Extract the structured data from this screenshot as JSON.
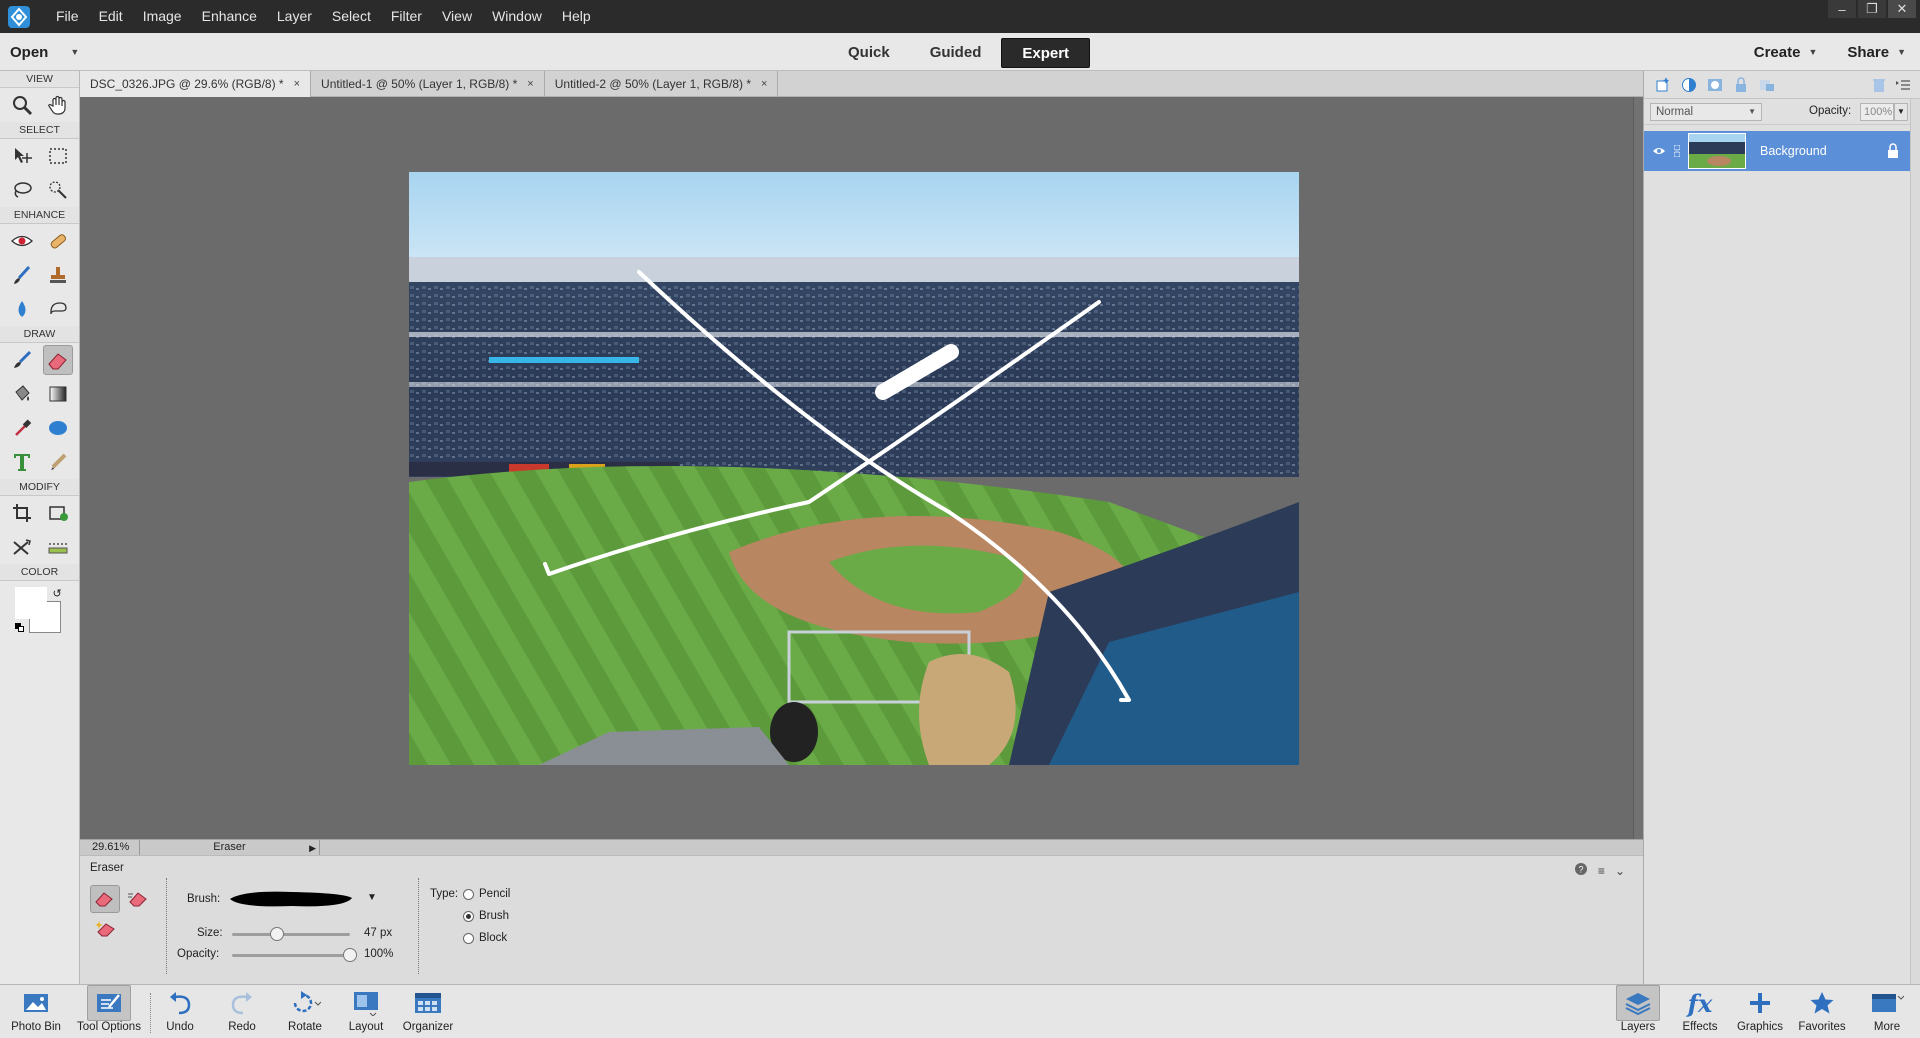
{
  "menubar": {
    "items": [
      "File",
      "Edit",
      "Image",
      "Enhance",
      "Layer",
      "Select",
      "Filter",
      "View",
      "Window",
      "Help"
    ]
  },
  "modebar": {
    "open_label": "Open",
    "modes": [
      "Quick",
      "Guided",
      "Expert"
    ],
    "active_mode": "Expert",
    "create_label": "Create",
    "share_label": "Share"
  },
  "toolbox": {
    "sections": {
      "view": "VIEW",
      "select": "SELECT",
      "enhance": "ENHANCE",
      "draw": "DRAW",
      "modify": "MODIFY",
      "color": "COLOR"
    },
    "active_tool": "eraser-tool",
    "foreground_color": "#000000",
    "background_color": "#ffffff"
  },
  "doctabs": [
    {
      "label": "DSC_0326.JPG @ 29.6% (RGB/8) *",
      "active": true
    },
    {
      "label": "Untitled-1 @ 50% (Layer 1, RGB/8) *",
      "active": false
    },
    {
      "label": "Untitled-2 @ 50% (Layer 1, RGB/8) *",
      "active": false
    }
  ],
  "statusbar": {
    "zoom": "29.61%",
    "tool_name": "Eraser"
  },
  "tool_options": {
    "title": "Eraser",
    "brush_label": "Brush:",
    "size_label": "Size:",
    "size_value": "47 px",
    "size_fraction": 0.38,
    "opacity_label": "Opacity:",
    "opacity_value": "100%",
    "opacity_fraction": 1.0,
    "type_label": "Type:",
    "types": [
      "Pencil",
      "Brush",
      "Block"
    ],
    "selected_type": "Brush"
  },
  "layers_panel": {
    "blend_mode": "Normal",
    "opacity_label": "Opacity:",
    "opacity_value": "100%",
    "layer_name": "Background",
    "highlight_color": "#5b8fd8"
  },
  "taskbar": {
    "left": [
      "Photo Bin",
      "Tool Options",
      "Undo",
      "Redo",
      "Rotate",
      "Layout",
      "Organizer"
    ],
    "right": [
      "Layers",
      "Effects",
      "Graphics",
      "Favorites",
      "More"
    ]
  },
  "colors": {
    "menubar_bg": "#2b2b2b",
    "canvas_bg": "#6b6b6b",
    "accent_blue": "#2f7fd1"
  }
}
